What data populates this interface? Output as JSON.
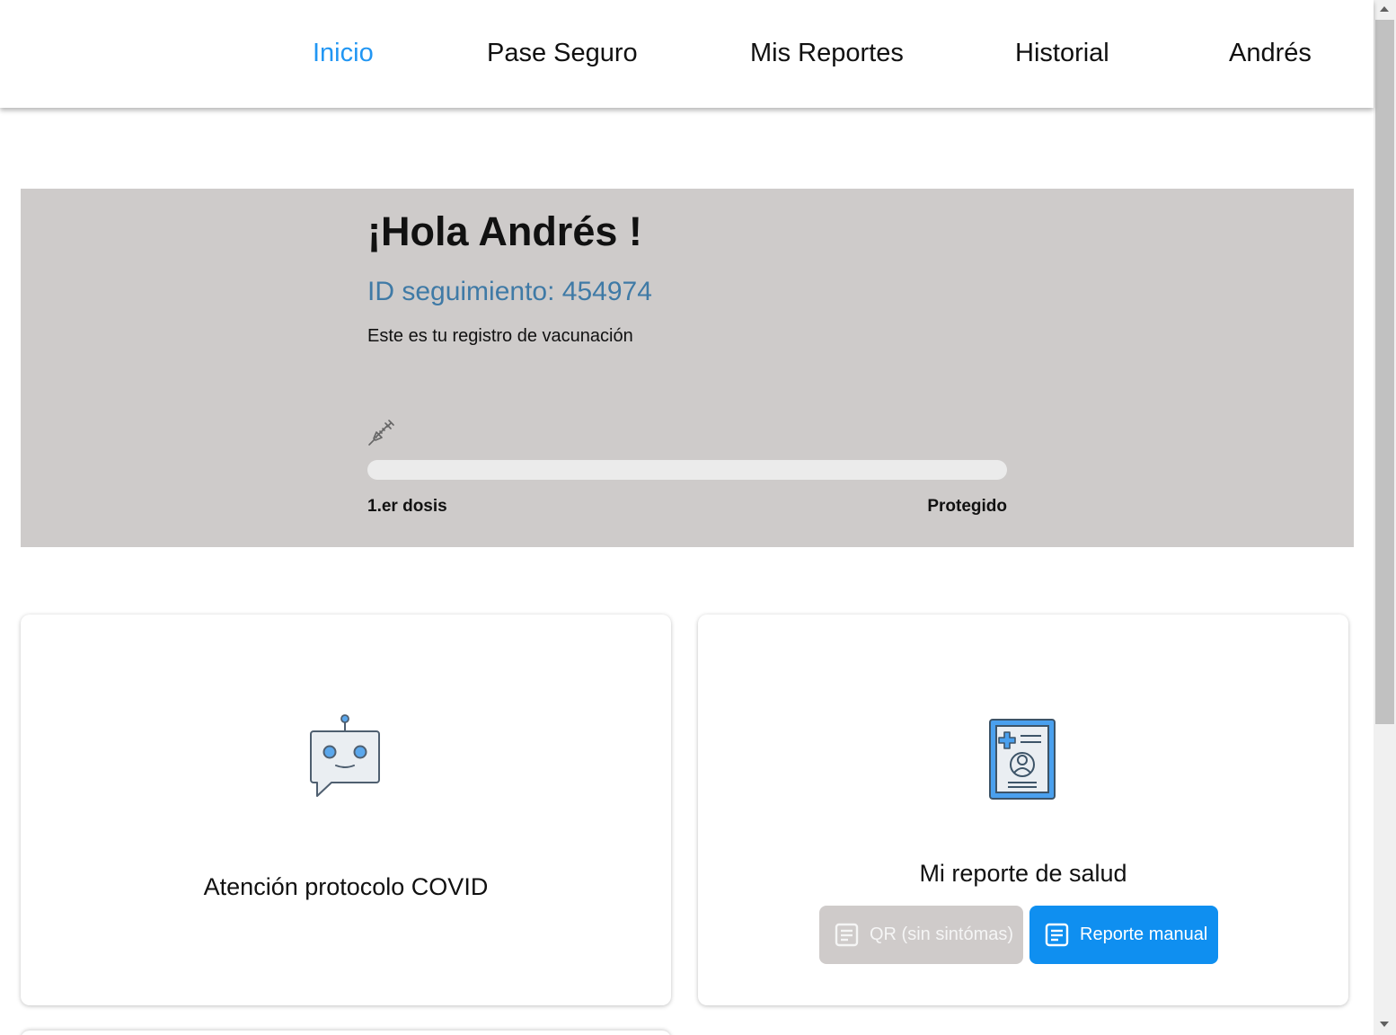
{
  "nav": {
    "items": [
      {
        "label": "Inicio",
        "active": true
      },
      {
        "label": "Pase Seguro",
        "active": false
      },
      {
        "label": "Mis Reportes",
        "active": false
      },
      {
        "label": "Historial",
        "active": false
      },
      {
        "label": "Andrés",
        "active": false
      }
    ]
  },
  "hero": {
    "greeting": "¡Hola Andrés !",
    "tracking_id": "ID seguimiento: 454974",
    "subtitle": "Este es tu registro de vacunación",
    "icon": "syringe-icon",
    "progress": {
      "value_fraction": 0.0,
      "start_label": "1.er dosis",
      "end_label": "Protegido"
    }
  },
  "cards": {
    "covid": {
      "icon": "robot-chat-icon",
      "title": "Atención protocolo COVID"
    },
    "health": {
      "icon": "medical-record-icon",
      "title": "Mi reporte de salud",
      "buttons": [
        {
          "icon": "document-icon",
          "label": "QR (sin sintómas)",
          "state": "disabled"
        },
        {
          "icon": "document-icon",
          "label": "Reporte manual",
          "state": "enabled"
        }
      ]
    }
  },
  "colors": {
    "accent": "#2196f3",
    "hero_bg": "#cecbca",
    "tracking_id": "#3f7aa6",
    "button_primary": "#0f8ff0",
    "button_disabled": "#cfcbca"
  }
}
